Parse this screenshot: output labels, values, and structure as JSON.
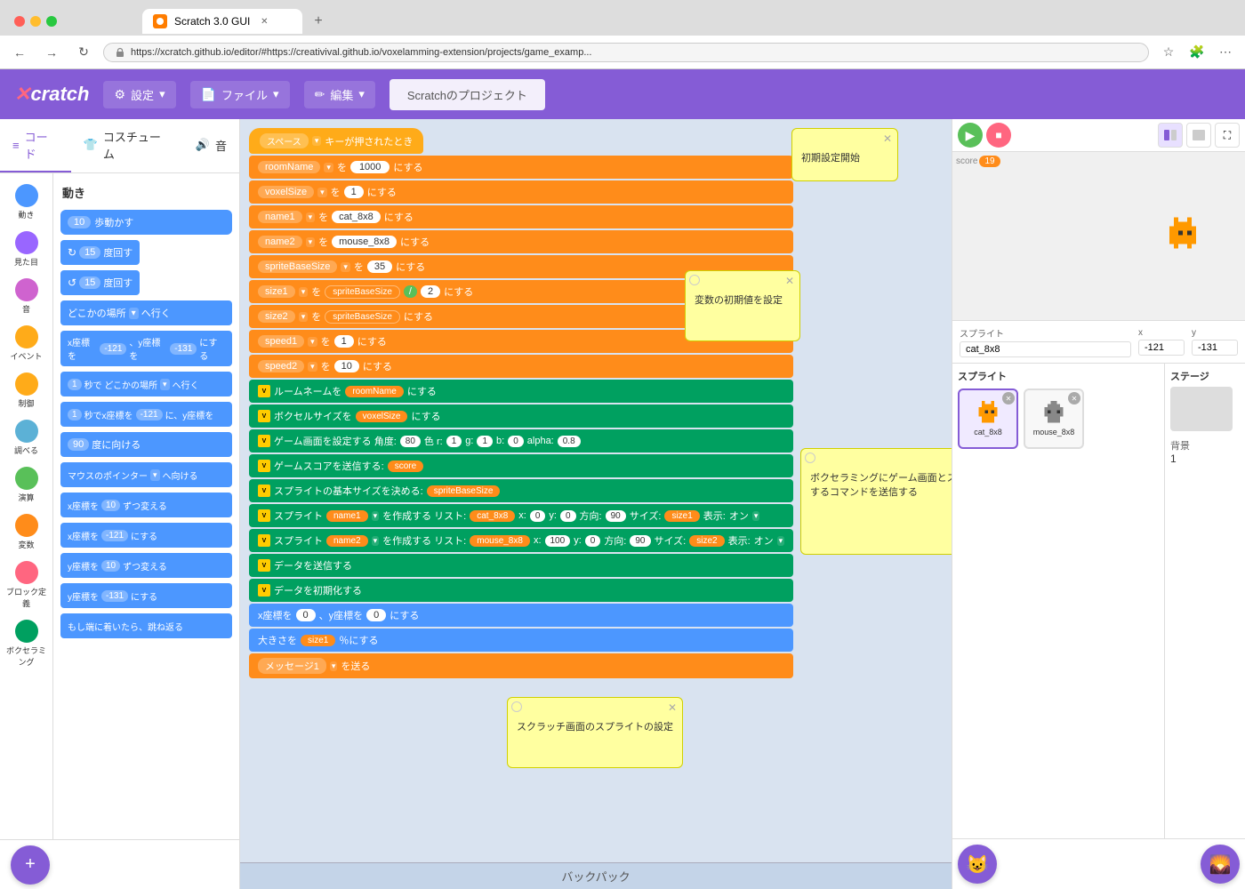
{
  "browser": {
    "tab_title": "Scratch 3.0 GUI",
    "url": "https://xcratch.github.io/editor/#https://creativival.github.io/voxelamming-extension/projects/game_examp...",
    "back_btn": "←",
    "forward_btn": "→",
    "refresh_btn": "↻"
  },
  "header": {
    "logo": "Xcratch",
    "settings_label": "設定",
    "file_label": "ファイル",
    "edit_label": "編集",
    "project_label": "Scratchのプロジェクト"
  },
  "tabs": {
    "code": "コード",
    "costumes": "コスチューム",
    "sounds": "音"
  },
  "categories": [
    {
      "id": "motion",
      "label": "動き",
      "color": "#4c97ff"
    },
    {
      "id": "looks",
      "label": "見た目",
      "color": "#9966ff"
    },
    {
      "id": "sound",
      "label": "音",
      "color": "#cf63cf"
    },
    {
      "id": "events",
      "label": "イベント",
      "color": "#ffab19"
    },
    {
      "id": "control",
      "label": "制御",
      "color": "#ffab19"
    },
    {
      "id": "sensing",
      "label": "調べる",
      "color": "#5cb1d6"
    },
    {
      "id": "operators",
      "label": "演算",
      "color": "#59c059"
    },
    {
      "id": "variables",
      "label": "変数",
      "color": "#ff8c1a"
    },
    {
      "id": "myblocks",
      "label": "ブロック定義",
      "color": "#ff6680"
    },
    {
      "id": "voxelamming",
      "label": "ボクセラミング",
      "color": "#00a060"
    }
  ],
  "blocks": {
    "section_title": "動き",
    "items": [
      {
        "id": "move",
        "label": "歩動かす",
        "num": "10",
        "color": "blue"
      },
      {
        "id": "turn_cw",
        "label": "度回す",
        "num": "15",
        "color": "blue"
      },
      {
        "id": "turn_ccw",
        "label": "度回す",
        "num": "15",
        "color": "blue"
      },
      {
        "id": "goto_random",
        "label": "どこかの場所 へ行く",
        "color": "blue"
      },
      {
        "id": "goto_xy",
        "label": "x座標を -121 、y座標を -131 にする",
        "color": "blue"
      },
      {
        "id": "glide_random",
        "label": "秒で どこかの場所 へ行く",
        "num": "1",
        "color": "blue"
      },
      {
        "id": "glide_xy",
        "label": "秒でx座標を -121 に、y座標を",
        "num": "1",
        "color": "blue"
      },
      {
        "id": "point_dir",
        "label": "度に向ける",
        "num": "90",
        "color": "blue"
      },
      {
        "id": "point_towards",
        "label": "マウスのポインター へ向ける",
        "color": "blue"
      },
      {
        "id": "change_x",
        "label": "x座標を 10 ずつ変える",
        "color": "blue"
      },
      {
        "id": "set_x",
        "label": "x座標を -121 にする",
        "color": "blue"
      },
      {
        "id": "change_y",
        "label": "y座標を 10 ずつ変える",
        "color": "blue"
      },
      {
        "id": "set_y",
        "label": "y座標を -131 にする",
        "color": "blue"
      },
      {
        "id": "if_on_edge",
        "label": "もし端に着いたら、跳ね返る",
        "color": "blue"
      }
    ]
  },
  "workspace": {
    "hat_label": "スペース キーが押されたとき",
    "blocks": [
      {
        "label": "roomName を 1000 にする",
        "type": "orange"
      },
      {
        "label": "voxelSize を 1 にする",
        "type": "orange"
      },
      {
        "label": "name1 を cat_8x8 にする",
        "type": "orange"
      },
      {
        "label": "name2 を mouse_8x8 にする",
        "type": "orange"
      },
      {
        "label": "spriteBaseSize を 35 にする",
        "type": "orange"
      },
      {
        "label": "size1 を spriteBaseSize / 2 にする",
        "type": "orange"
      },
      {
        "label": "size2 を spriteBaseSize にする",
        "type": "orange"
      },
      {
        "label": "speed1 を 1 にする",
        "type": "orange"
      },
      {
        "label": "speed2 を 10 にする",
        "type": "orange"
      }
    ],
    "voxel_blocks": [
      {
        "label": "ルームネームを roomName にする"
      },
      {
        "label": "ボクセルサイズを voxelSize にする"
      },
      {
        "label": "ゲーム画面を設定する 角度: 80 色 r: 1 g: 1 b: 0 alpha: 0.8"
      },
      {
        "label": "ゲームスコアを送信する: score"
      },
      {
        "label": "スプライトの基本サイズを決める: spriteBaseSize"
      },
      {
        "label": "スプライト name1 を作成する リスト: cat_8x8 x: 0 y: 0 方向: 90 サイズ: size1 表示: オン"
      },
      {
        "label": "スプライト name2 を作成する リスト: mouse_8x8 x: 100 y: 0 方向: 90 サイズ: size2 表示: オン"
      },
      {
        "label": "データを送信する"
      },
      {
        "label": "データを初期化する"
      }
    ]
  },
  "notes": [
    {
      "id": "vars_note",
      "title": "変数の初期値を設定",
      "text": "変数の初期値を設定"
    },
    {
      "id": "init_note",
      "title": "初期設定開始",
      "text": "初期設定開始"
    },
    {
      "id": "voxel_note",
      "title": "ボクセラミングにゲーム画面とスプライトを作成するコマンドを送信する",
      "text": "ボクセラミングにゲーム画面とスプライトを作成するコマンドを送信する"
    },
    {
      "id": "scratch_note",
      "title": "スクラッチ画面のスプライトの設定",
      "text": "スクラッチ画面のスプライトの設定"
    }
  ],
  "bottom_blocks": [
    {
      "label": "x座標を 0 、y座標を 0 にする",
      "type": "blue"
    },
    {
      "label": "大きさを size1 ％にする",
      "type": "blue"
    },
    {
      "label": "メッセージ1 を送る",
      "type": "orange"
    }
  ],
  "stage": {
    "sprite_name": "cat_8x8",
    "x_label": "x",
    "x_value": "-121",
    "y_label": "y",
    "y_value": "-131",
    "stage_label": "ステージ",
    "background_label": "背景",
    "background_num": "1",
    "score_label": "score",
    "score_value": "19"
  },
  "sprites": [
    {
      "id": "cat_8x8",
      "label": "cat_8x8"
    },
    {
      "id": "mouse_8x8",
      "label": "mouse_8x8"
    }
  ],
  "backpack": {
    "label": "バックパック"
  },
  "zoom_in": "+",
  "zoom_out": "-",
  "zoom_reset": "="
}
